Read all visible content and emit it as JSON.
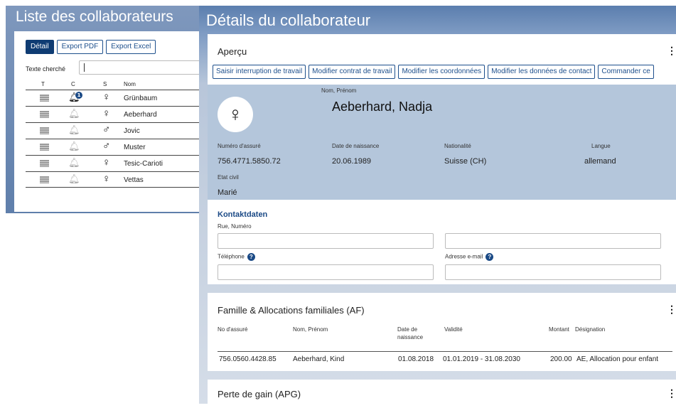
{
  "list_window": {
    "title": "Liste des collaborateurs",
    "buttons": [
      "Détail",
      "Export PDF",
      "Export Excel"
    ],
    "search_label": "Texte cherché",
    "search_value": "",
    "columns": [
      "T",
      "C",
      "S",
      "Nom"
    ],
    "rows": [
      {
        "name": "Grünbaum",
        "gender": "♀",
        "notification_active": true,
        "notification_count": "1"
      },
      {
        "name": "Aeberhard",
        "gender": "♀",
        "notification_active": false,
        "notification_count": ""
      },
      {
        "name": "Jovic",
        "gender": "♂",
        "notification_active": false,
        "notification_count": ""
      },
      {
        "name": "Muster",
        "gender": "♂",
        "notification_active": false,
        "notification_count": ""
      },
      {
        "name": "Tesic-Carioti",
        "gender": "♀",
        "notification_active": false,
        "notification_count": ""
      },
      {
        "name": "Vettas",
        "gender": "♀",
        "notification_active": false,
        "notification_count": ""
      }
    ],
    "icons": {
      "type": "document-icon",
      "notification": "bell-icon"
    }
  },
  "detail_window": {
    "title": "Détails du collaborateur",
    "overview": {
      "title": "Aperçu",
      "menu_glyph": "⋮",
      "actions": [
        "Saisir interruption de travail",
        "Modifier contrat de travail",
        "Modifier les coordonnées",
        "Modifier les données de contact",
        "Commander ce"
      ],
      "avatar_glyph": "♀",
      "name_label": "Nom, Prénom",
      "name_value": "Aeberhard, Nadja",
      "fields": {
        "insured_no_label": "Numéro d'assuré",
        "insured_no": "756.4771.5850.72",
        "birth_label": "Date de naissance",
        "birth": "20.06.1989",
        "nationality_label": "Nationalité",
        "nationality": "Suisse (CH)",
        "language_label": "Langue",
        "language": "allemand",
        "civil_label": "Etat civil",
        "civil": "Marié"
      },
      "contact": {
        "heading": "Kontaktdaten",
        "street_label": "Rue, Numéro",
        "street_value": "",
        "street2_value": "",
        "phone_label": "Téléphone",
        "phone_value": "",
        "email_label": "Adresse e-mail",
        "email_value": "",
        "help_glyph": "?"
      }
    },
    "family": {
      "title": "Famille & Allocations familiales (AF)",
      "menu_glyph": "⋮",
      "columns": [
        "No d'assuré",
        "Nom, Prénom",
        "Date de naissance",
        "Validité",
        "Montant",
        "Désignation"
      ],
      "rows": [
        {
          "insured_no": "756.0560.4428.85",
          "name": "Aeberhard, Kind",
          "birth": "01.08.2018",
          "validity": "01.01.2019 - 31.08.2030",
          "amount": "200.00",
          "designation": "AE, Allocation pour enfant"
        }
      ]
    },
    "apg": {
      "title": "Perte de gain (APG)",
      "menu_glyph": "⋮"
    }
  },
  "colors": {
    "accent": "#0f3c73",
    "profile_bg": "#b4c6db",
    "header_gradient": "#5b7eae"
  }
}
